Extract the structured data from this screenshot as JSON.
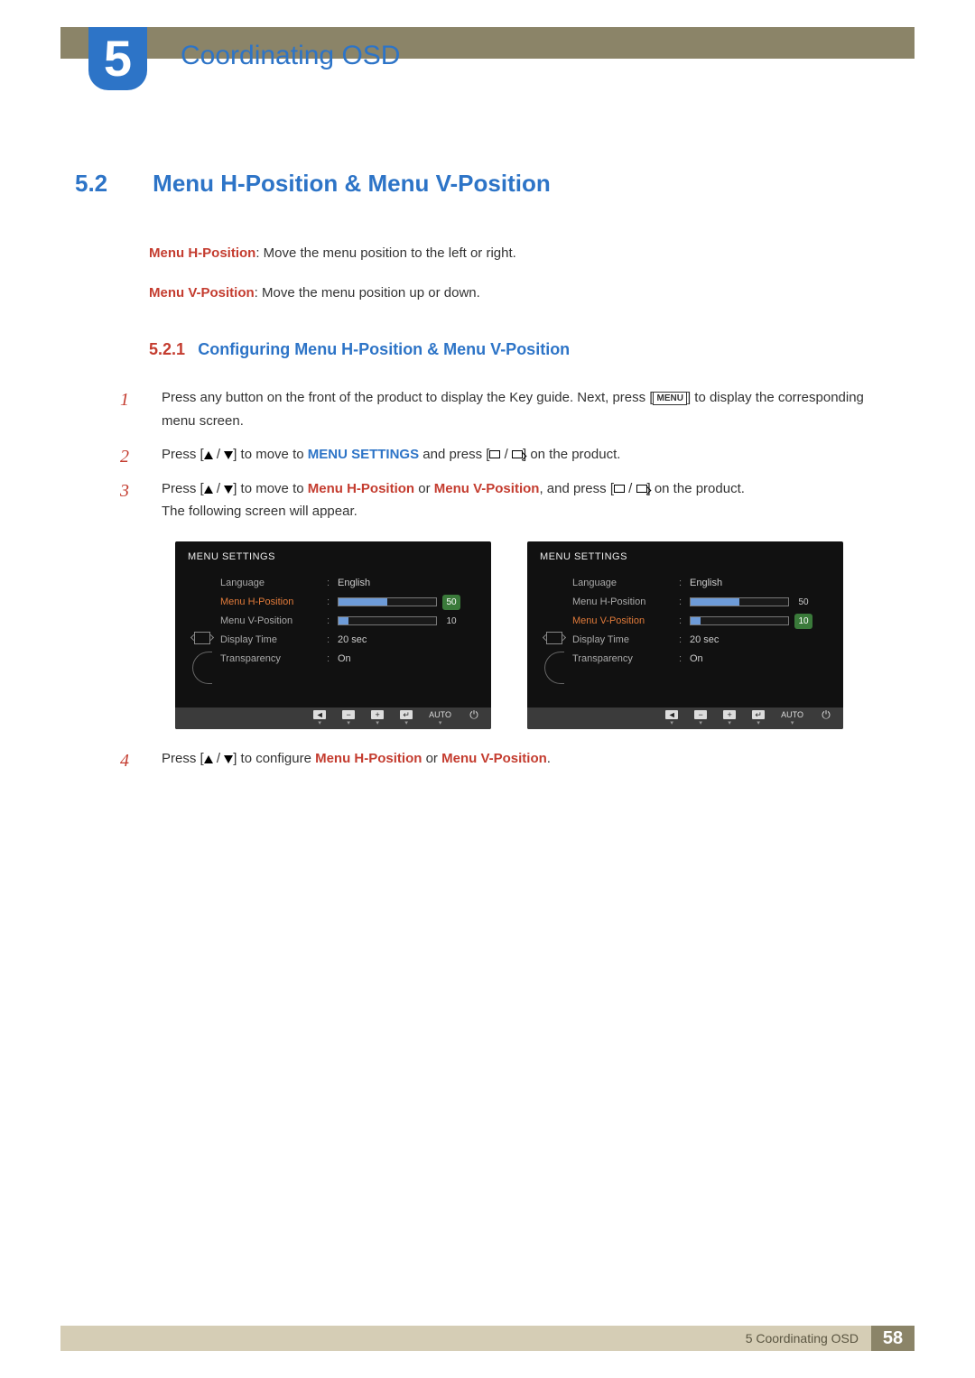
{
  "chapter": {
    "number": "5",
    "title": "Coordinating OSD"
  },
  "section": {
    "number": "5.2",
    "title": "Menu H-Position & Menu V-Position"
  },
  "definitions": {
    "h": {
      "label": "Menu H-Position",
      "text": ": Move the menu position to the left or right."
    },
    "v": {
      "label": "Menu V-Position",
      "text": ": Move the menu position up or down."
    }
  },
  "subsection": {
    "number": "5.2.1",
    "title": "Configuring Menu H-Position & Menu V-Position"
  },
  "steps": {
    "s1": {
      "num": "1",
      "a": "Press any button on the front of the product to display the Key guide. Next, press [",
      "menu": "MENU",
      "b": "] to display the corresponding menu screen."
    },
    "s2": {
      "num": "2",
      "a": "Press [",
      "b": "] to move to ",
      "target": "MENU SETTINGS",
      "c": " and press [",
      "d": "] on the product."
    },
    "s3": {
      "num": "3",
      "a": "Press [",
      "b": "] to move to ",
      "t1": "Menu H-Position",
      "or": " or ",
      "t2": "Menu V-Position",
      "c": ", and press [",
      "d": "] on the product.",
      "e": "The following screen will appear."
    },
    "s4": {
      "num": "4",
      "a": "Press [",
      "b": "] to configure ",
      "t1": "Menu H-Position",
      "or": " or ",
      "t2": "Menu V-Position",
      "dot": "."
    }
  },
  "osd": {
    "title": "MENU SETTINGS",
    "items": {
      "language": {
        "label": "Language",
        "value": "English"
      },
      "hpos": {
        "label": "Menu H-Position",
        "value": 50
      },
      "vpos": {
        "label": "Menu V-Position",
        "value": 10
      },
      "display": {
        "label": "Display Time",
        "value": "20 sec"
      },
      "transp": {
        "label": "Transparency",
        "value": "On"
      }
    },
    "footer_auto": "AUTO"
  },
  "footer": {
    "label": "5 Coordinating OSD",
    "page": "58"
  }
}
